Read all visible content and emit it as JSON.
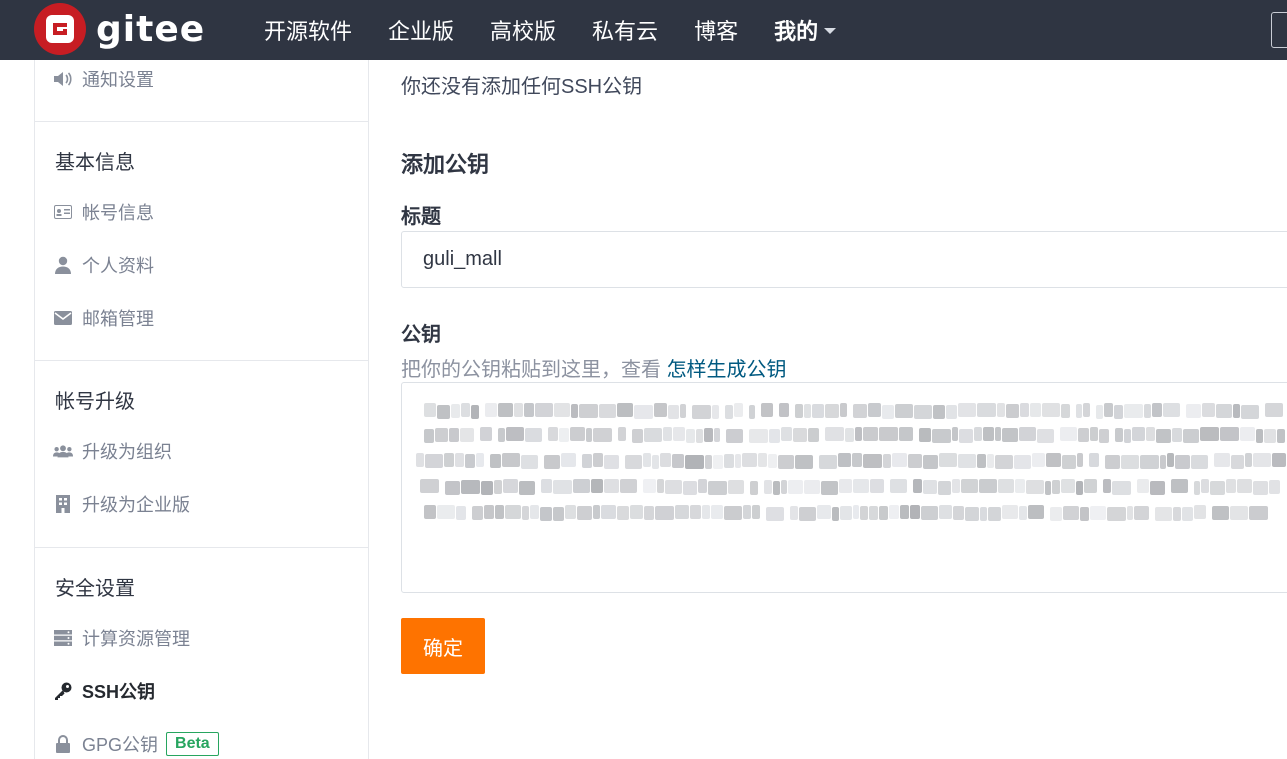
{
  "topbar": {
    "logo_letter": "G",
    "brand": "gitee",
    "nav": [
      "开源软件",
      "企业版",
      "高校版",
      "私有云",
      "博客"
    ],
    "mine": "我的"
  },
  "sidebar": {
    "notify_item": {
      "label": "通知设置",
      "icon": "volume-icon"
    },
    "sections": [
      {
        "title": "基本信息",
        "items": [
          {
            "label": "帐号信息",
            "icon": "id-card-icon"
          },
          {
            "label": "个人资料",
            "icon": "user-icon"
          },
          {
            "label": "邮箱管理",
            "icon": "envelope-icon"
          }
        ]
      },
      {
        "title": "帐号升级",
        "items": [
          {
            "label": "升级为组织",
            "icon": "users-icon"
          },
          {
            "label": "升级为企业版",
            "icon": "building-icon"
          }
        ]
      },
      {
        "title": "安全设置",
        "items": [
          {
            "label": "计算资源管理",
            "icon": "server-icon"
          },
          {
            "label": "SSH公钥",
            "icon": "key-icon",
            "active": true
          },
          {
            "label": "GPG公钥",
            "icon": "lock-icon",
            "badge": "Beta"
          }
        ]
      }
    ]
  },
  "main": {
    "empty_hint": "你还没有添加任何SSH公钥",
    "add_title": "添加公钥",
    "title_label": "标题",
    "title_value": "guli_mall",
    "key_label": "公钥",
    "key_hint": "把你的公钥粘贴到这里，查看",
    "key_hint_link": "怎样生成公钥",
    "submit": "确定"
  },
  "colors": {
    "topbar": "#2f3542",
    "brand_red": "#c71d23",
    "submit_orange": "#fe7300",
    "link": "#005980",
    "beta_green": "#27a55f"
  }
}
